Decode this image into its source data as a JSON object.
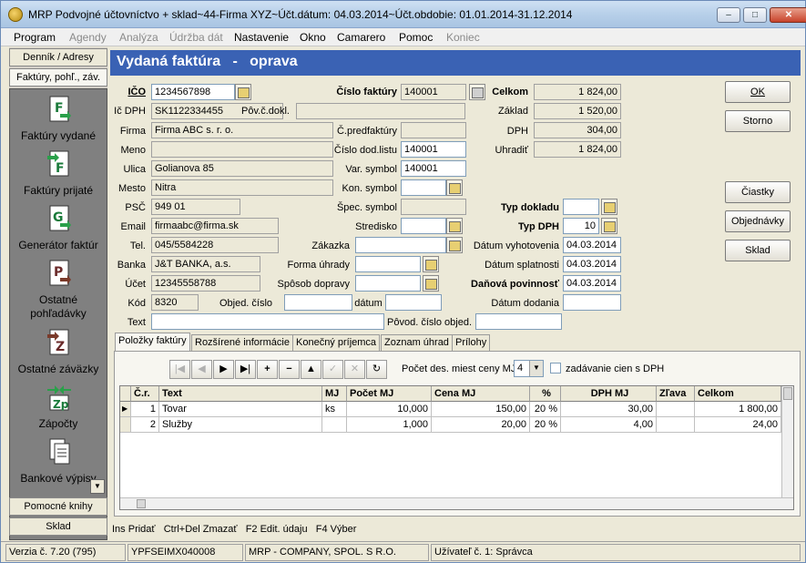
{
  "window": {
    "title": "MRP Podvojné účtovníctvo + sklad~44-Firma XYZ~Účt.dátum: 04.03.2014~Účt.obdobie: 01.01.2014-31.12.2014",
    "min": "–",
    "max": "□",
    "close": "✕"
  },
  "menu": [
    {
      "label": "Program",
      "enabled": true
    },
    {
      "label": "Agendy",
      "enabled": false
    },
    {
      "label": "Analýza",
      "enabled": false
    },
    {
      "label": "Údržba dát",
      "enabled": false
    },
    {
      "label": "Nastavenie",
      "enabled": true
    },
    {
      "label": "Okno",
      "enabled": true
    },
    {
      "label": "Camarero",
      "enabled": true
    },
    {
      "label": "Pomoc",
      "enabled": true
    },
    {
      "label": "Koniec",
      "enabled": false
    }
  ],
  "sidebar": {
    "top_tabs": [
      "Denník / Adresy",
      "Faktúry, pohľ., záv."
    ],
    "items": [
      "Faktúry vydané",
      "Faktúry prijaté",
      "Generátor faktúr",
      "Ostatné pohľadávky",
      "Ostatné záväzky",
      "Zápočty",
      "Bankové výpisy"
    ],
    "icon_letters": [
      "F",
      "F",
      "G",
      "P",
      "Z",
      "Zp",
      ""
    ],
    "bottom_tabs": [
      "Pomocné knihy",
      "Sklad"
    ],
    "scroll_arrow": "▼"
  },
  "form": {
    "header_title": "Vydaná faktúra",
    "header_dash": "-",
    "header_mode": "oprava",
    "labels": {
      "ico": "IČO",
      "icdph": "Ič DPH",
      "firma": "Firma",
      "meno": "Meno",
      "ulica": "Ulica",
      "mesto": "Mesto",
      "psc": "PSČ",
      "email": "Email",
      "tel": "Tel.",
      "banka": "Banka",
      "ucet": "Účet",
      "kod": "Kód",
      "text": "Text",
      "cislo_faktury": "Číslo faktúry",
      "pov_c_dokl": "Pôv.č.dokl.",
      "c_predfaktury": "Č.predfaktúry",
      "cislo_dod_listu": "Číslo dod.listu",
      "var_symbol": "Var. symbol",
      "kon_symbol": "Kon. symbol",
      "spec_symbol": "Špec. symbol",
      "stredisko": "Stredisko",
      "zakazka": "Zákazka",
      "forma_uhrady": "Forma úhrady",
      "sposob_dopravy": "Spôsob dopravy",
      "objed_cislo": "Objed. číslo",
      "datum": "dátum",
      "pov_cislo_objed": "Pôvod. číslo objed.",
      "celkom": "Celkom",
      "zaklad": "Základ",
      "dph": "DPH",
      "uhradit": "Uhradiť",
      "typ_dokladu": "Typ dokladu",
      "typ_dph": "Typ DPH",
      "datum_vyhotovenia": "Dátum vyhotovenia",
      "datum_splatnosti": "Dátum splatnosti",
      "danova_povinnost": "Daňová povinnosť",
      "datum_dodania": "Dátum dodania"
    },
    "values": {
      "ico": "1234567898",
      "icdph": "SK1122334455",
      "firma": "Firma ABC s. r. o.",
      "meno": "",
      "ulica": "Golianova 85",
      "mesto": "Nitra",
      "psc": "949 01",
      "email": "firmaabc@firma.sk",
      "tel": "045/5584228",
      "banka": "J&T BANKA, a.s.",
      "ucet": "12345558788",
      "kod": "8320",
      "text": "",
      "cislo_faktury": "140001",
      "pov_c_dokl": "",
      "c_predfaktury": "",
      "cislo_dod_listu": "140001",
      "var_symbol": "140001",
      "kon_symbol": "",
      "spec_symbol": "",
      "stredisko": "",
      "zakazka": "",
      "forma_uhrady": "",
      "sposob_dopravy": "",
      "objed_cislo": "",
      "datum": "",
      "pov_cislo_objed": "",
      "celkom": "1 824,00",
      "zaklad": "1 520,00",
      "dph": "304,00",
      "uhradit": "1 824,00",
      "typ_dokladu": "",
      "typ_dph": "10",
      "datum_vyhotovenia": "04.03.2014",
      "datum_splatnosti": "04.03.2014",
      "danova_povinnost": "04.03.2014",
      "datum_dodania": ""
    },
    "buttons": {
      "ok": "OK",
      "storno": "Storno",
      "ciastky": "Čiastky",
      "objednavky": "Objednávky",
      "sklad": "Sklad"
    }
  },
  "tabs": [
    "Položky faktúry",
    "Rozšírené informácie",
    "Konečný príjemca",
    "Zoznam úhrad",
    "Prílohy"
  ],
  "toolbar": {
    "nav": [
      "|◀",
      "◀",
      "▶",
      "▶|",
      "+",
      "−",
      "▲",
      "✓",
      "✕",
      "↻"
    ],
    "decimals_label": "Počet des. miest ceny MJ",
    "decimals_value": "4",
    "dph_checkbox_label": "zadávanie cien s DPH",
    "dph_checkbox_checked": false
  },
  "grid": {
    "columns": [
      "Č.r.",
      "Text",
      "MJ",
      "Počet MJ",
      "Cena MJ",
      "%",
      "DPH MJ",
      "Zľava",
      "Celkom"
    ],
    "rows": [
      {
        "cr": "1",
        "text": "Tovar",
        "mj": "ks",
        "pocet": "10,000",
        "cena": "150,00",
        "pct": "20 %",
        "dph": "30,00",
        "zlava": "",
        "celkom": "1 800,00"
      },
      {
        "cr": "2",
        "text": "Služby",
        "mj": "",
        "pocet": "1,000",
        "cena": "20,00",
        "pct": "20 %",
        "dph": "4,00",
        "zlava": "",
        "celkom": "24,00"
      }
    ]
  },
  "hints": "Ins Pridať   Ctrl+Del Zmazať   F2 Edit. údaju   F4 Výber",
  "statusbar": [
    "Verzia č. 7.20 (795)",
    "YPFSEIMX040008",
    "MRP - COMPANY, SPOL. S R.O.",
    "Užívateľ č. 1: Správca"
  ]
}
